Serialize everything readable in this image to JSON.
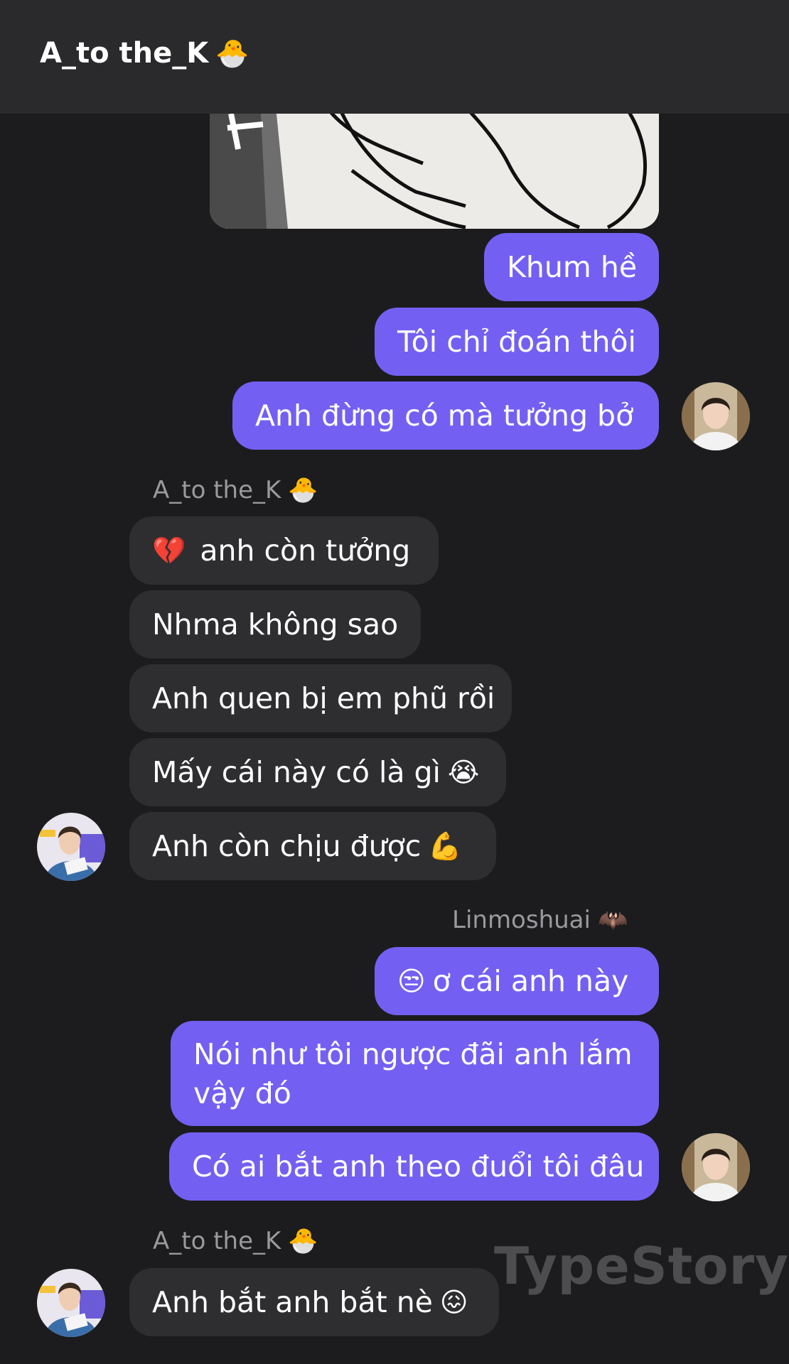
{
  "header": {
    "title": "A_to the_K",
    "emoji": "🐣"
  },
  "messages": [
    {
      "text": "Khum hề"
    },
    {
      "text": "Tôi chỉ đoán thôi"
    },
    {
      "text": "Anh đừng có mà tưởng bở"
    },
    {
      "sender": "A_to the_K",
      "sender_emoji": "🐣"
    },
    {
      "emoji": "💔",
      "text": "anh còn tưởng"
    },
    {
      "text": "Nhma không sao"
    },
    {
      "text": "Anh quen bị em phũ rồi"
    },
    {
      "text": "Mấy cái này có là gì",
      "emoji": "😭"
    },
    {
      "text": "Anh còn chịu được",
      "emoji": "💪"
    },
    {
      "sender": "Linmoshuai",
      "sender_emoji": "🦇"
    },
    {
      "emoji": "😒",
      "text": "ơ cái anh này"
    },
    {
      "text": "Nói như tôi ngược đãi anh lắm vậy đó"
    },
    {
      "text": "Có ai bắt anh theo đuổi tôi đâu"
    },
    {
      "sender": "A_to the_K",
      "sender_emoji": "🐣"
    },
    {
      "text": "Anh bắt anh bắt nè",
      "emoji": "😖"
    }
  ],
  "watermark": "TypeStory",
  "colors": {
    "outgoing": "#7360f2",
    "incoming": "#2e2e30",
    "background": "#1c1c1e"
  }
}
